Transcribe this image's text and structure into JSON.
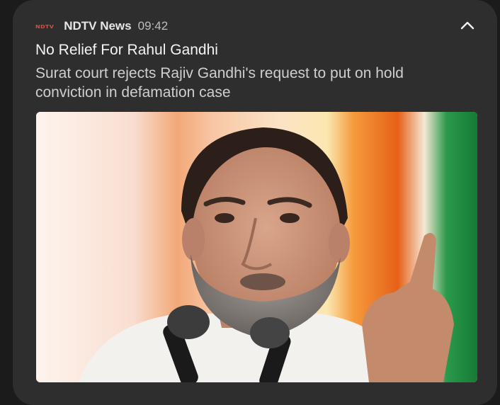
{
  "notification": {
    "app_icon": "NDTV",
    "app_name": "NDTV News",
    "time": "09:42",
    "collapse_icon": "chevron-up-icon",
    "title": "No Relief For Rahul Gandhi",
    "body": "Surat court rejects Rajiv Gandhi's request to put on hold conviction in defamation case",
    "image": {
      "content": "photo-man-speaking-at-microphones",
      "background_colors": [
        "#f7862a",
        "#ffffff",
        "#1e8a3f"
      ]
    }
  }
}
